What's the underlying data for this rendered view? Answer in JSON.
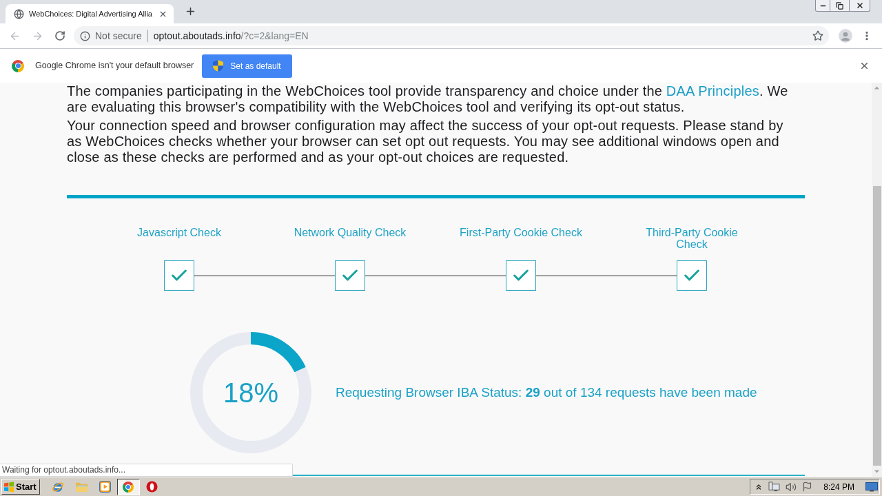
{
  "tabs": [
    {
      "title": "WebChoices: Digital Advertising Allia",
      "selected": true
    }
  ],
  "toolbar": {
    "security_label": "Not secure",
    "url_host": "optout.aboutads.info",
    "url_rest": "/?c=2&lang=EN"
  },
  "infobar": {
    "message": "Google Chrome isn't your default browser",
    "button": "Set as default"
  },
  "page": {
    "intro": {
      "before": "The companies participating in the WebChoices tool provide transparency and choice under the ",
      "link": "DAA Principles",
      "after": ". We are evaluating this browser's compatibility with the WebChoices tool and verifying its opt-out status."
    },
    "notice": "Your connection speed and browser configuration may affect the success of your opt-out requests. Please stand by as WebChoices checks whether your browser can set opt out requests. You may see additional windows open and close as these checks are performed and as your opt-out choices are requested.",
    "steps": [
      {
        "label": "Javascript Check",
        "checked": true
      },
      {
        "label": "Network Quality Check",
        "checked": true
      },
      {
        "label": "First-Party Cookie Check",
        "checked": true
      },
      {
        "label": "Third-Party Cookie Check",
        "checked": true
      }
    ],
    "progress": {
      "level": 0.18,
      "reading": "18%"
    },
    "status": "Requesting Browser IBA Status: **29** out of 134 requests have been made"
  },
  "status_bubble": "Waiting for optout.aboutads.info...",
  "taskbar": {
    "start": "Start",
    "apps": [
      {
        "kind": "ie",
        "active": false
      },
      {
        "kind": "folder",
        "active": false
      },
      {
        "kind": "media",
        "active": false
      },
      {
        "kind": "chrome",
        "active": true
      },
      {
        "kind": "opera",
        "active": false
      }
    ],
    "clock": "8:24 PM"
  }
}
